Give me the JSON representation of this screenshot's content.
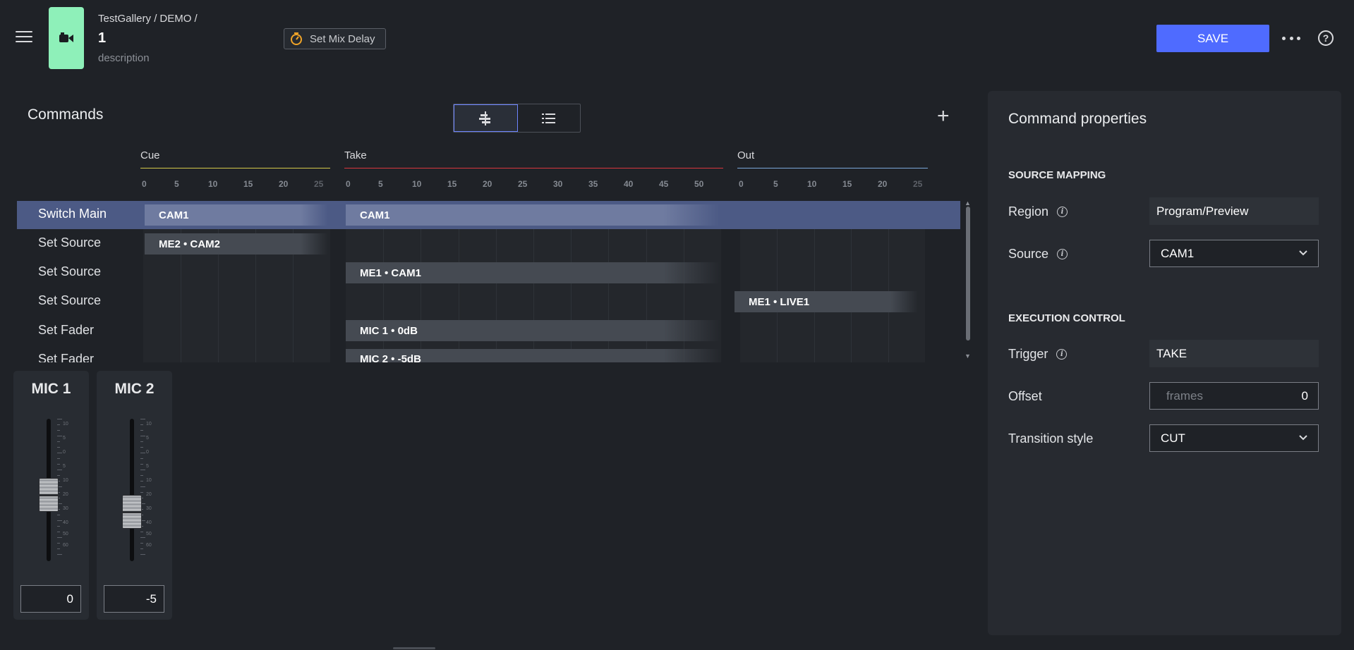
{
  "header": {
    "breadcrumb": [
      "TestGallery /",
      "DEMO /"
    ],
    "title": "1",
    "subtitle": "description",
    "mix_delay_label": "Set Mix Delay",
    "save_label": "SAVE",
    "help_label": "?",
    "app_icon": "video-camera-icon",
    "accent_color": "#8ef0b9",
    "save_color": "#4f6bff"
  },
  "commands": {
    "title": "Commands",
    "add_label": "+",
    "lanes": [
      {
        "name": "Cue",
        "color": "#d4c94a",
        "ticks": [
          "0",
          "5",
          "10",
          "15",
          "20",
          "25"
        ]
      },
      {
        "name": "Take",
        "color": "#d9363e",
        "ticks": [
          "0",
          "5",
          "10",
          "15",
          "20",
          "25",
          "30",
          "35",
          "40",
          "45",
          "50"
        ]
      },
      {
        "name": "Out",
        "color": "#7aa7d9",
        "ticks": [
          "0",
          "5",
          "10",
          "15",
          "20",
          "25"
        ]
      }
    ],
    "rows": [
      {
        "label": "Switch Main",
        "selected": true
      },
      {
        "label": "Set Source"
      },
      {
        "label": "Set Source"
      },
      {
        "label": "Set Source"
      },
      {
        "label": "Set Fader"
      },
      {
        "label": "Set Fader"
      }
    ],
    "blocks": [
      {
        "text": "CAM1"
      },
      {
        "text": "CAM1"
      },
      {
        "text": "ME2 • CAM2"
      },
      {
        "text": "ME1 • CAM1"
      },
      {
        "text": "ME1 • LIVE1"
      },
      {
        "text": "MIC 1 • 0dB"
      },
      {
        "text": "MIC 2 • -5dB"
      }
    ]
  },
  "mixer": {
    "scale": [
      "10",
      "5",
      "0",
      "5",
      "10",
      "20",
      "30",
      "40",
      "50",
      "60"
    ],
    "channels": [
      {
        "name": "MIC 1",
        "value": "0",
        "level_db": 0
      },
      {
        "name": "MIC 2",
        "value": "-5",
        "level_db": -5
      }
    ]
  },
  "properties": {
    "title": "Command properties",
    "source_mapping": "SOURCE MAPPING",
    "region_label": "Region",
    "region_value": "Program/Preview",
    "source_label": "Source",
    "source_value": "CAM1",
    "execution_control": "EXECUTION CONTROL",
    "trigger_label": "Trigger",
    "trigger_value": "TAKE",
    "offset_label": "Offset",
    "offset_placeholder": "frames",
    "offset_value": "0",
    "transition_label": "Transition style",
    "transition_value": "CUT"
  }
}
